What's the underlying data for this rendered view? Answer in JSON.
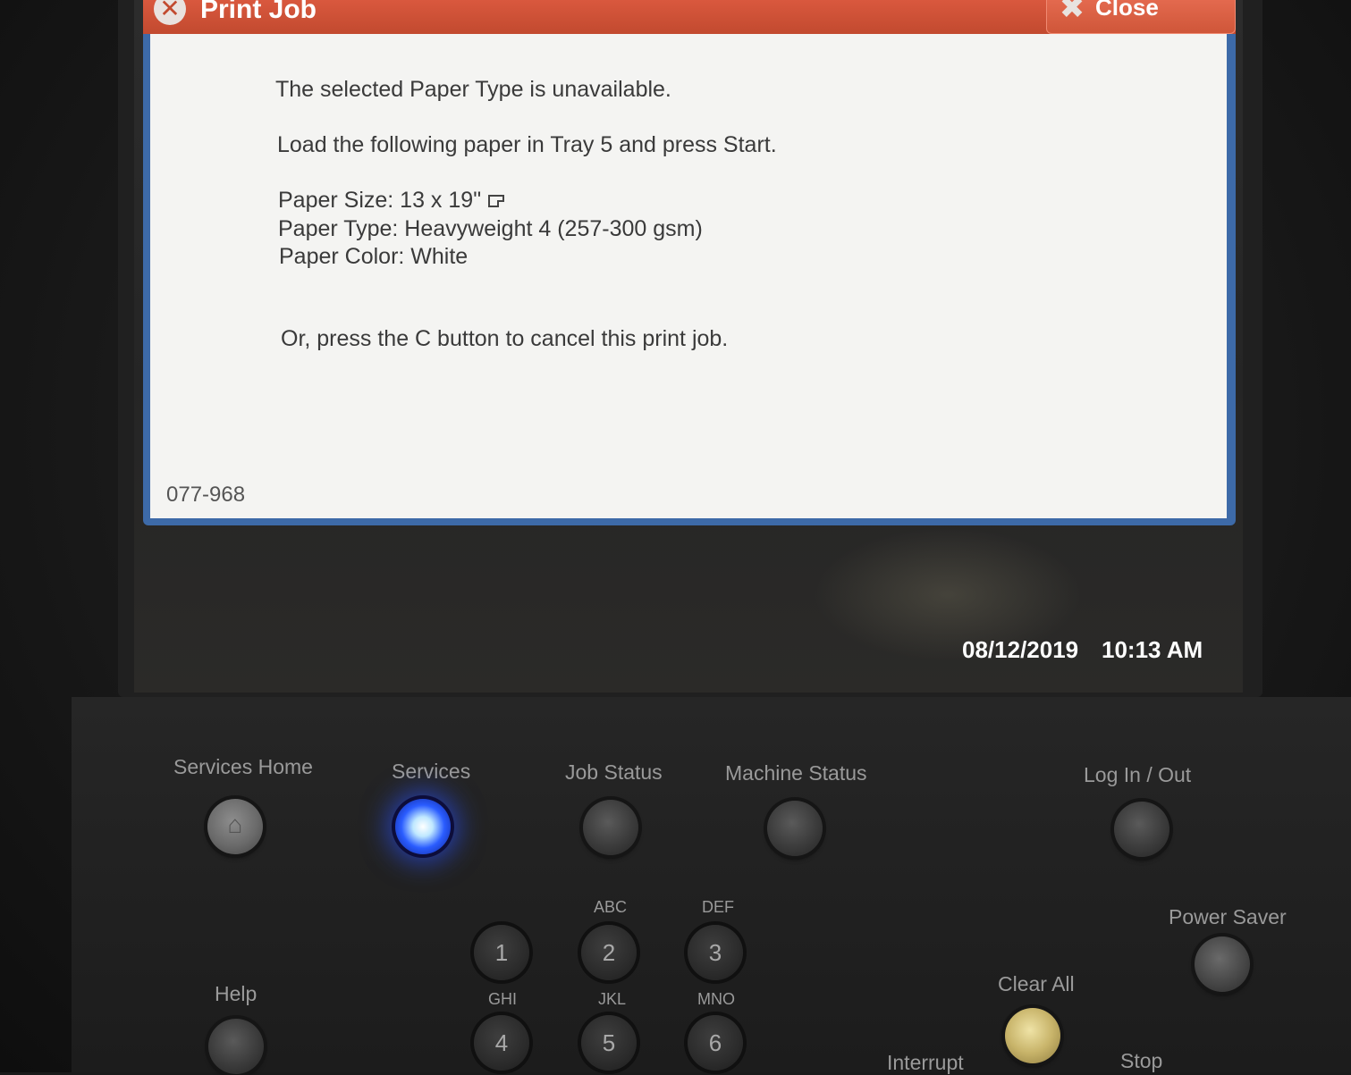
{
  "dialog": {
    "title": "Print Job",
    "close_label": "Close",
    "lines": {
      "unavailable": "The selected Paper Type is unavailable.",
      "instruction": "Load the following paper in Tray 5 and press Start.",
      "paper_size": "Paper Size: 13 x 19\"",
      "paper_type": "Paper Type: Heavyweight 4 (257-300 gsm)",
      "paper_color": "Paper Color: White",
      "cancel_hint": "Or, press the C button to cancel this print job."
    },
    "error_code": "077-968"
  },
  "status_bar": {
    "date": "08/12/2019",
    "time": "10:13 AM"
  },
  "panel": {
    "services_home": "Services Home",
    "services": "Services",
    "job_status": "Job Status",
    "machine_status": "Machine Status",
    "log_in_out": "Log In / Out",
    "power_saver": "Power Saver",
    "help": "Help",
    "clear_all": "Clear All",
    "interrupt": "Interrupt",
    "stop": "Stop",
    "services_light_color": "#2a5cff",
    "clear_all_color": "#c8b46a"
  },
  "keypad": {
    "k1": "1",
    "k2": "2",
    "k3": "3",
    "k4": "4",
    "k5": "5",
    "k6": "6",
    "abc": "ABC",
    "def": "DEF",
    "ghi": "GHI",
    "jkl": "JKL",
    "mno": "MNO"
  }
}
